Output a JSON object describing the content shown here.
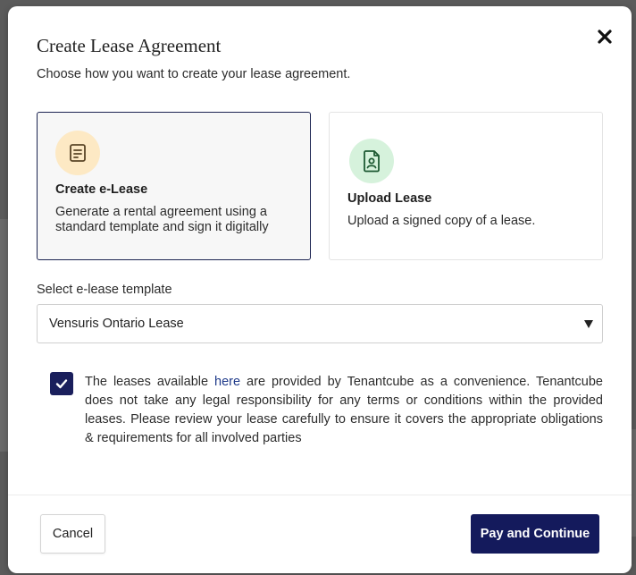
{
  "modal": {
    "title": "Create Lease Agreement",
    "subtitle": "Choose how you want to create your lease agreement.",
    "close_icon": "close-x-icon"
  },
  "options": [
    {
      "title": "Create e-Lease",
      "description": "Generate a rental agreement using a standard template and sign it digitally",
      "icon": "document-list-icon",
      "icon_bg": "#fde9c4",
      "selected": true
    },
    {
      "title": "Upload Lease",
      "description": "Upload a signed copy of a lease.",
      "icon": "document-person-icon",
      "icon_bg": "#d6f2dc",
      "selected": false
    }
  ],
  "template_select": {
    "label": "Select e-lease template",
    "value": "Vensuris Ontario Lease"
  },
  "disclaimer": {
    "checked": true,
    "text_before": "The leases available ",
    "link_text": "here",
    "text_after": " are provided by Tenantcube as a convenience. Tenantcube does not take any legal responsibility for any terms or conditions within the provided leases. Please review your lease carefully to ensure it covers the appropriate obligations & requirements for all involved parties"
  },
  "footer": {
    "cancel_label": "Cancel",
    "primary_label": "Pay and Continue"
  },
  "colors": {
    "primary": "#141a5c",
    "link": "#1f3a8a",
    "selected_border": "#1c2452"
  }
}
